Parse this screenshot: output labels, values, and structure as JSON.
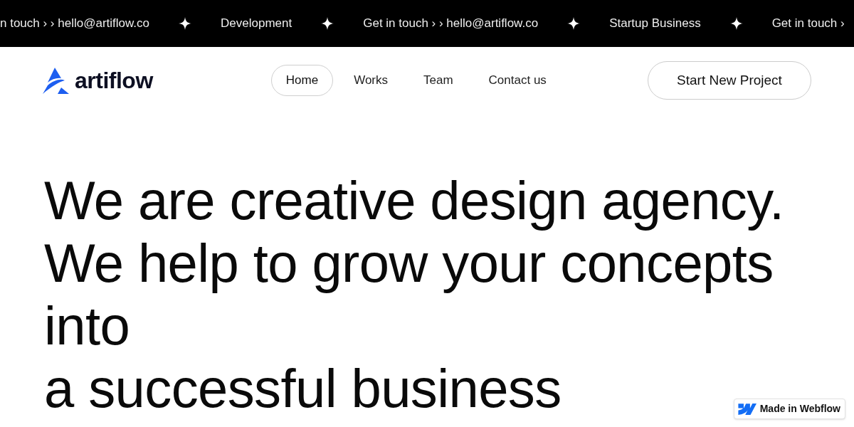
{
  "ticker": {
    "items": [
      "n touch › › hello@artiflow.co",
      "Development",
      "Get in touch › › hello@artiflow.co",
      "Startup Business",
      "Get in touch ›"
    ]
  },
  "header": {
    "logo": {
      "text": "artiflow"
    },
    "nav": [
      {
        "label": "Home",
        "selected": true
      },
      {
        "label": "Works",
        "selected": false
      },
      {
        "label": "Team",
        "selected": false
      },
      {
        "label": "Contact us",
        "selected": false
      }
    ],
    "cta": "Start New Project"
  },
  "hero": {
    "heading": [
      "We are creative design agency. We help to grow your concepts into",
      "a successful business"
    ]
  },
  "badge": {
    "text": "Made in Webflow"
  }
}
